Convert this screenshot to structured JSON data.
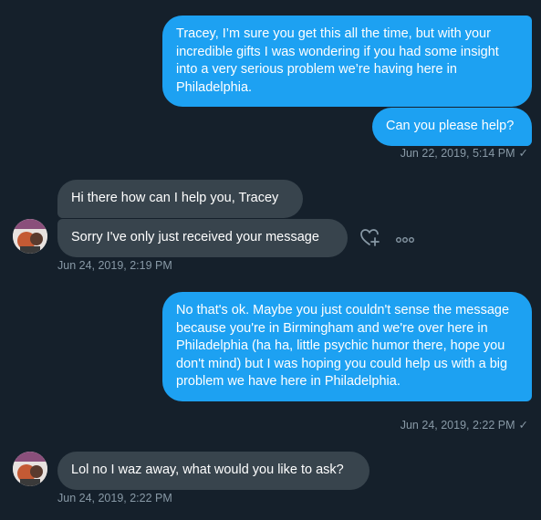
{
  "conversation": {
    "outgoing_1": {
      "message_1": "Tracey, I’m sure you get this all the time, but with your incredible gifts I was wondering if you had some insight into a very serious problem we’re having here in Philadelphia.",
      "message_2": "Can you please help?",
      "timestamp": "Jun 22, 2019, 5:14 PM",
      "status_icon": "check-mark"
    },
    "incoming_1": {
      "message_1": "Hi there how can I help you, Tracey",
      "message_2": "Sorry I've only just received your message",
      "timestamp": "Jun 24, 2019, 2:19 PM",
      "reaction_icon": "heart-plus",
      "more_icon": "more-dots"
    },
    "outgoing_2": {
      "message": "No that's ok. Maybe you just couldn't sense the message because you're in Birmingham and we're over here in Philadelphia (ha ha, little psychic humor there, hope you don't mind) but I was hoping you could help us with a big problem we have here in Philadelphia.",
      "timestamp": "Jun 24, 2019, 2:22 PM",
      "status_icon": "check-mark"
    },
    "incoming_2": {
      "message": "Lol no I waz away, what would you like to ask?",
      "timestamp": "Jun 24, 2019, 2:22 PM"
    }
  },
  "colors": {
    "background": "#15202b",
    "outgoing_bubble": "#1da1f2",
    "incoming_bubble": "#38444d",
    "meta_text": "#8899a6"
  }
}
